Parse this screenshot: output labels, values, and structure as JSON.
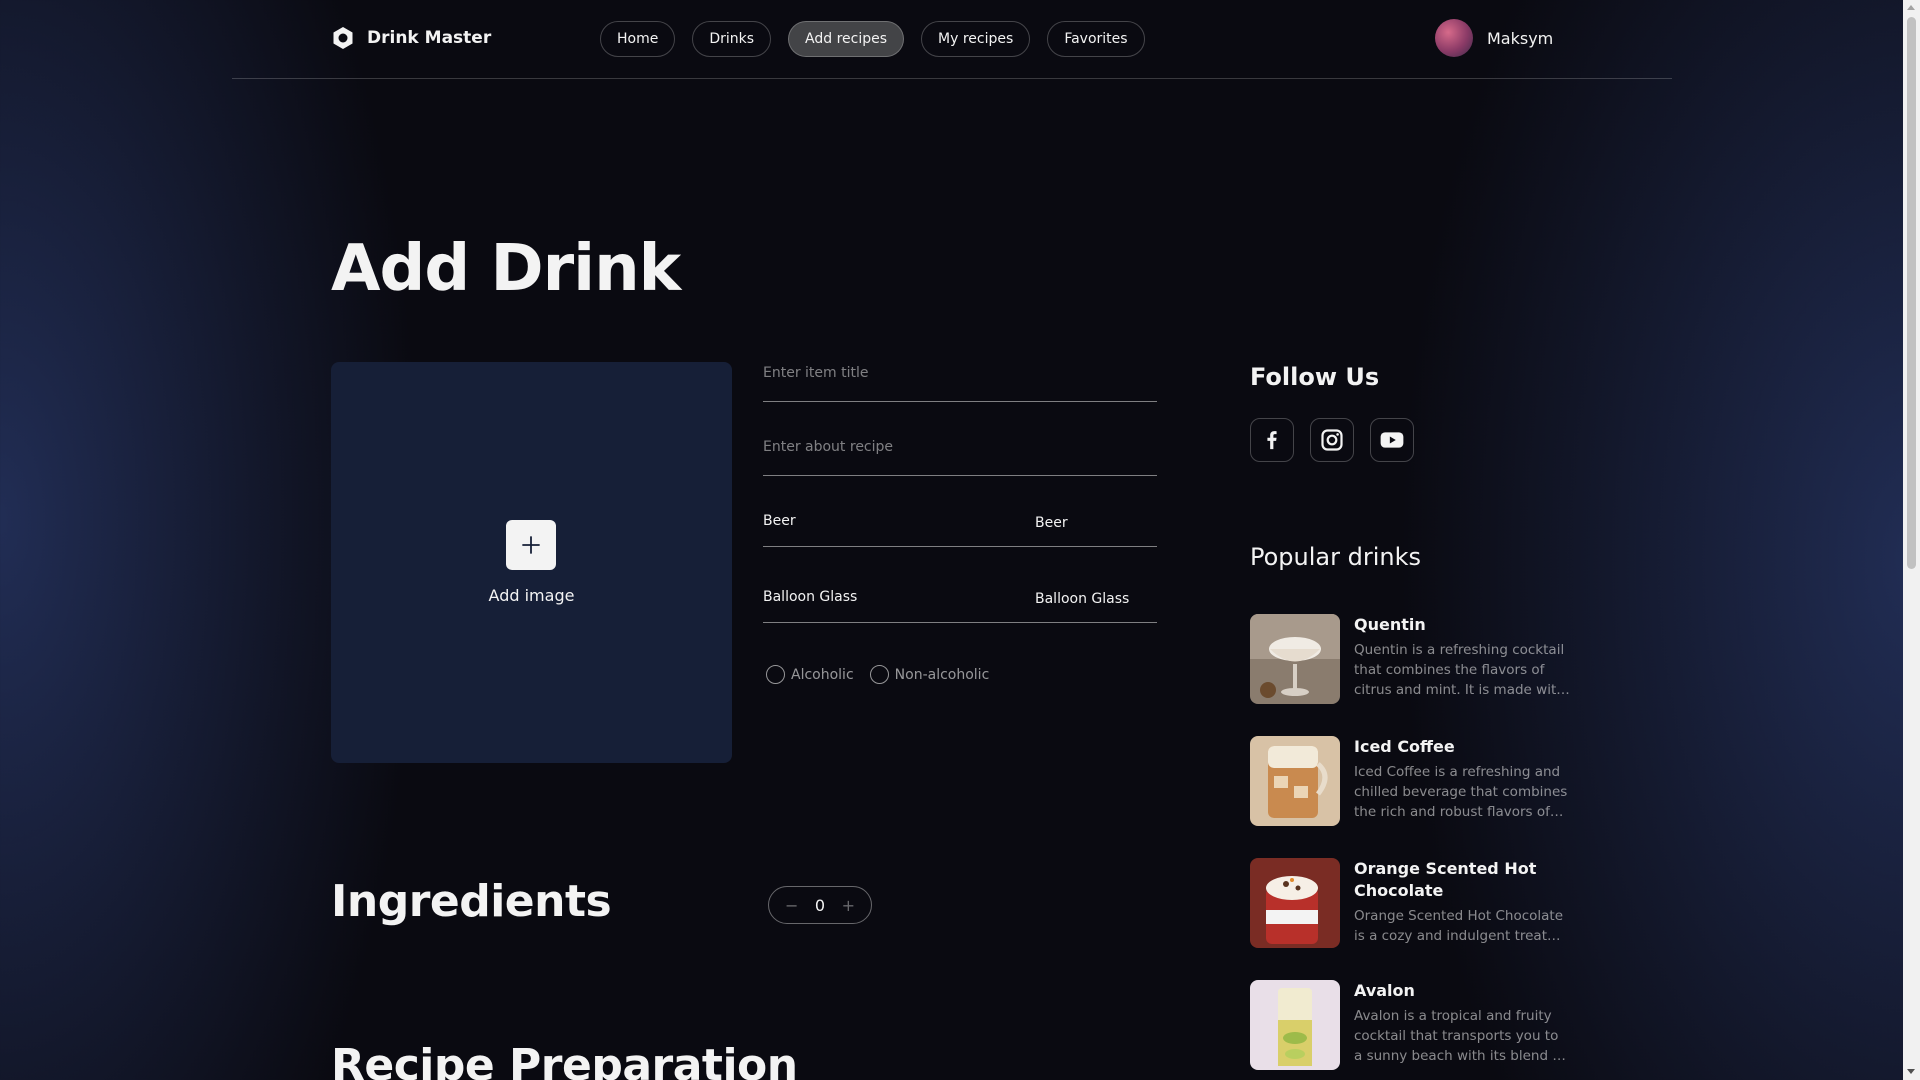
{
  "header": {
    "logo_text": "Drink Master",
    "nav": [
      {
        "label": "Home",
        "active": false
      },
      {
        "label": "Drinks",
        "active": false
      },
      {
        "label": "Add recipes",
        "active": true
      },
      {
        "label": "My recipes",
        "active": false
      },
      {
        "label": "Favorites",
        "active": false
      }
    ],
    "user_name": "Maksym"
  },
  "page": {
    "title": "Add Drink"
  },
  "upload": {
    "label": "Add image"
  },
  "form": {
    "title_placeholder": "Enter item title",
    "about_placeholder": "Enter about recipe",
    "category": {
      "label": "Beer",
      "value": "Beer"
    },
    "glass": {
      "label": "Balloon Glass",
      "value": "Balloon Glass"
    },
    "radios": [
      {
        "label": "Alcoholic",
        "checked": false
      },
      {
        "label": "Non-alcoholic",
        "checked": false
      }
    ]
  },
  "ingredients": {
    "title": "Ingredients",
    "count": "0",
    "minus": "−",
    "plus": "+"
  },
  "preparation": {
    "title": "Recipe Preparation"
  },
  "follow": {
    "title": "Follow Us",
    "icons": [
      "facebook-icon",
      "instagram-icon",
      "youtube-icon"
    ]
  },
  "popular": {
    "title": "Popular drinks",
    "drinks": [
      {
        "name": "Quentin",
        "description": "Quentin is a refreshing cocktail that combines the flavors of citrus and mint. It is made with fresh lime juice, mint leaves and soda."
      },
      {
        "name": "Iced Coffee",
        "description": "Iced Coffee is a refreshing and chilled beverage that combines the rich and robust flavors of coffee with ice."
      },
      {
        "name": "Orange Scented Hot Chocolate",
        "description": "Orange Scented Hot Chocolate is a cozy and indulgent treat perfect for cold days."
      },
      {
        "name": "Avalon",
        "description": "Avalon is a tropical and fruity cocktail that transports you to a sunny beach with its blend of flavors."
      }
    ]
  },
  "colors": {
    "background": "#0a0a11",
    "card": "#161f37",
    "text": "#f3f3f3",
    "active_nav": "#434447"
  }
}
